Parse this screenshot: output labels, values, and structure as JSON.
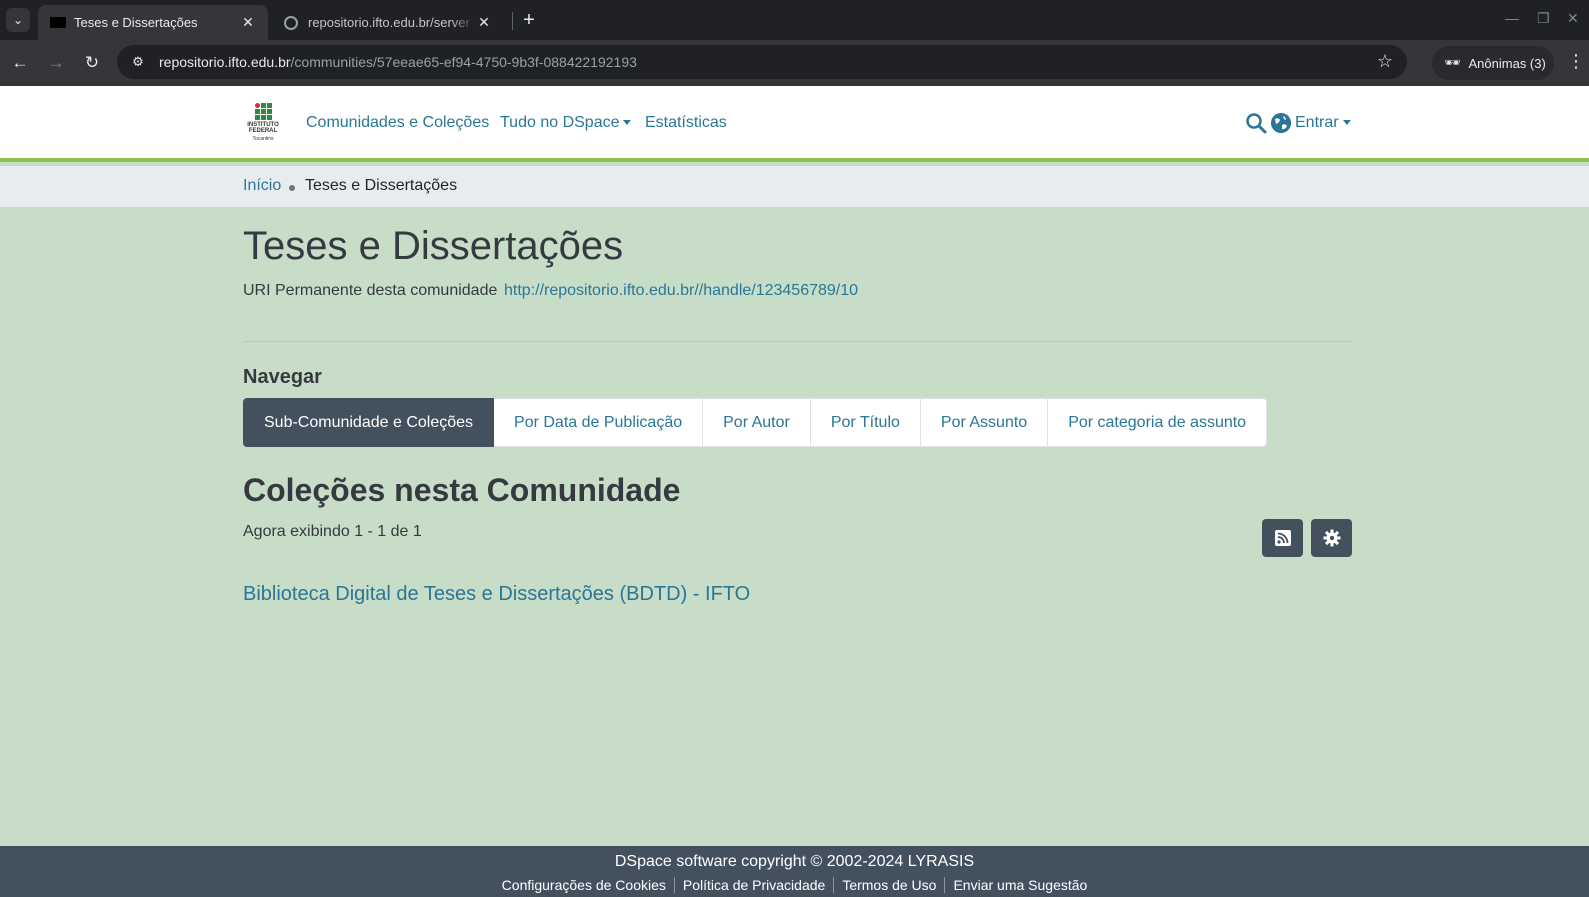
{
  "browser": {
    "tabs": [
      {
        "title": "Teses e Dissertações",
        "active": true
      },
      {
        "title": "repositorio.ifto.edu.br/server",
        "active": false
      }
    ],
    "url_host": "repositorio.ifto.edu.br",
    "url_path": "/communities/57eeae65-ef94-4750-9b3f-088422192193",
    "profile_label": "Anônimas (3)"
  },
  "header": {
    "logo_text": "INSTITUTO FEDERAL",
    "logo_subtext": "Tocantins",
    "nav": {
      "communities": "Comunidades e Coleções",
      "browse_all": "Tudo no DSpace",
      "statistics": "Estatísticas"
    },
    "login_label": "Entrar"
  },
  "breadcrumb": {
    "home": "Início",
    "current": "Teses e Dissertações"
  },
  "main": {
    "title": "Teses e Dissertações",
    "uri_label": "URI Permanente desta comunidade",
    "uri_link": "http://repositorio.ifto.edu.br//handle/123456789/10",
    "browse_label": "Navegar",
    "browse_buttons": [
      "Sub-Comunidade e Coleções",
      "Por Data de Publicação",
      "Por Autor",
      "Por Título",
      "Por Assunto",
      "Por categoria de assunto"
    ],
    "collections_title": "Coleções nesta Comunidade",
    "showing_text": "Agora exibindo 1 - 1 de 1",
    "collections": [
      "Biblioteca Digital de Teses e Dissertações (BDTD) - IFTO"
    ]
  },
  "footer": {
    "copyright": "DSpace software copyright © 2002-2024 LYRASIS",
    "links": [
      "Configurações de Cookies",
      "Política de Privacidade",
      "Termos de Uso",
      "Enviar uma Sugestão"
    ]
  },
  "colors": {
    "link": "#2a7696",
    "accent_green": "#8fc04a",
    "page_bg": "#c8ddc8",
    "dark_slate": "#43515f"
  }
}
